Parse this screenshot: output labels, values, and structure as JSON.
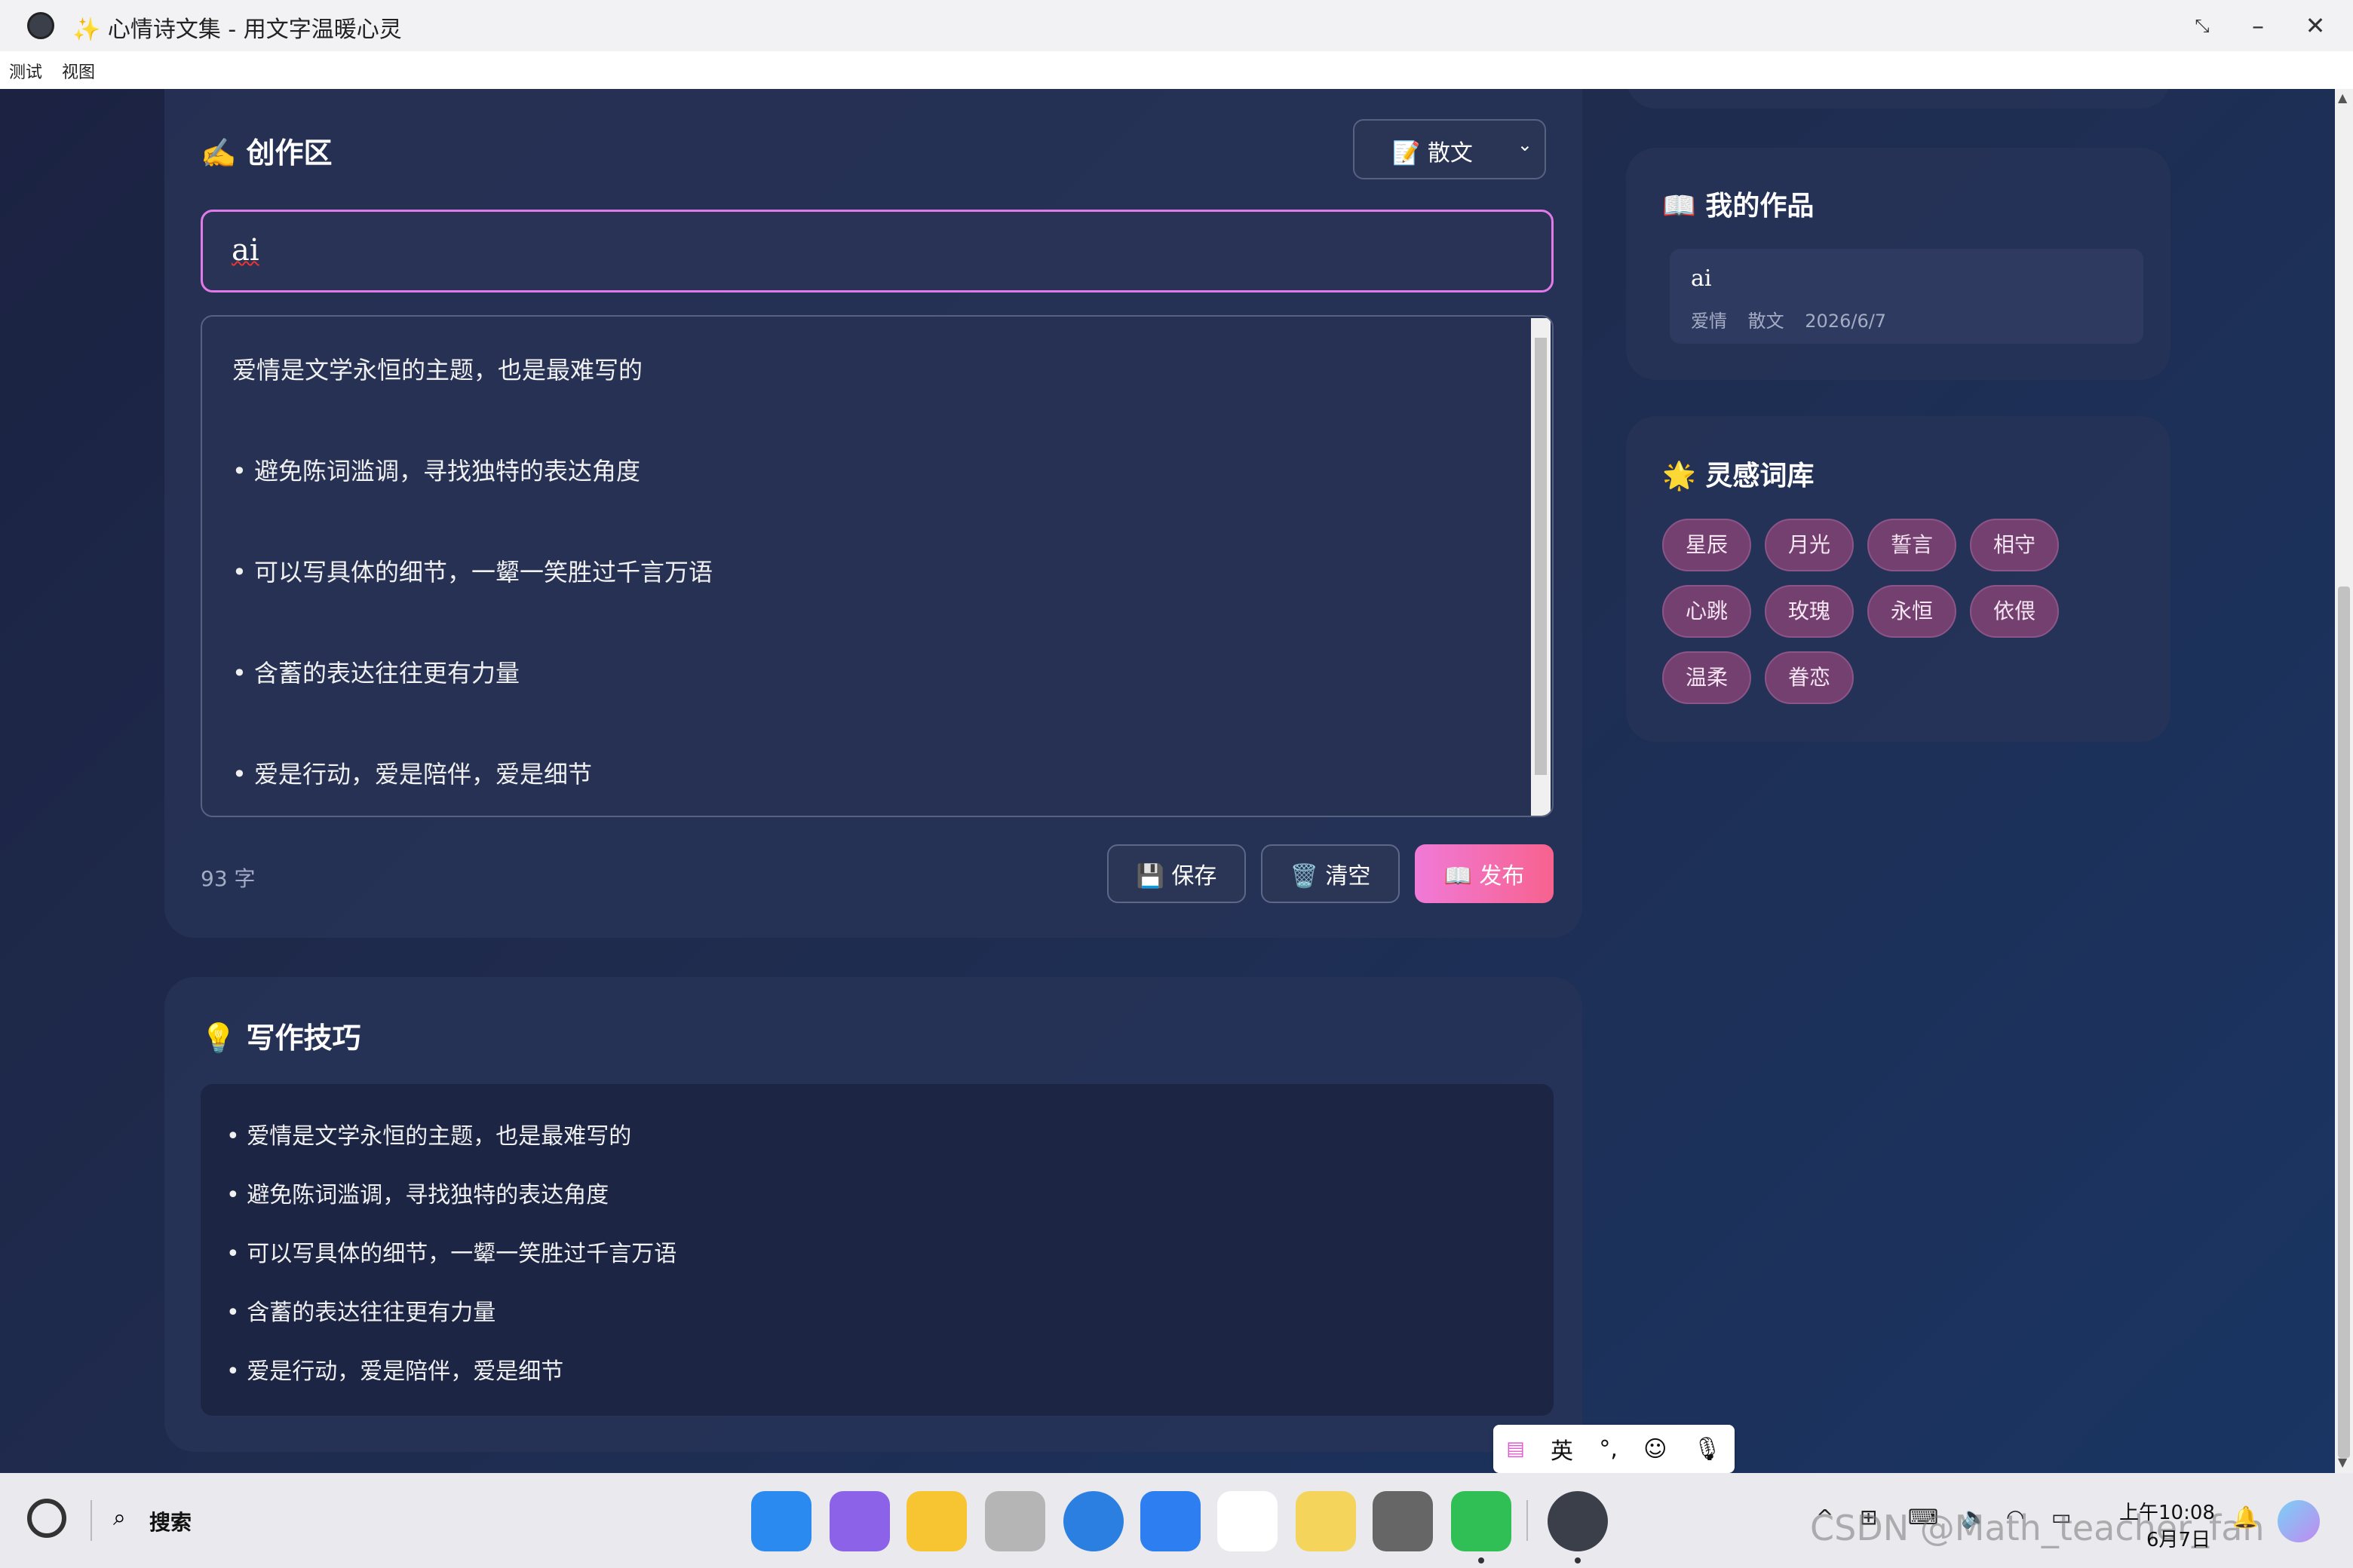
{
  "window": {
    "title": "✨ 心情诗文集 - 用文字温暖心灵"
  },
  "menu": {
    "items": [
      "测试",
      "视图"
    ]
  },
  "editor": {
    "heading": "✍️ 创作区",
    "genre_select": "📝 散文",
    "title_value": "ai",
    "content_lines": [
      "爱情是文学永恒的主题，也是最难写的",
      "• 避免陈词滥调，寻找独特的表达角度",
      "• 可以写具体的细节，一颦一笑胜过千言万语",
      "• 含蓄的表达往往更有力量",
      "• 爱是行动，爱是陪伴，爱是细节"
    ],
    "char_count": "93 字",
    "buttons": {
      "save": "💾 保存",
      "clear": "🗑️ 清空",
      "publish": "📖 发布"
    }
  },
  "tips": {
    "heading": "💡 写作技巧",
    "lines": [
      "• 爱情是文学永恒的主题，也是最难写的",
      "• 避免陈词滥调，寻找独特的表达角度",
      "• 可以写具体的细节，一颦一笑胜过千言万语",
      "• 含蓄的表达往往更有力量",
      "• 爱是行动，爱是陪伴，爱是细节"
    ]
  },
  "my_works": {
    "heading": "📖 我的作品",
    "items": [
      {
        "title": "ai",
        "mood": "爱情",
        "genre": "散文",
        "date": "2026/6/7"
      }
    ]
  },
  "inspiration": {
    "heading": "🌟 灵感词库",
    "tags": [
      "星辰",
      "月光",
      "誓言",
      "相守",
      "心跳",
      "玫瑰",
      "永恒",
      "依偎",
      "温柔",
      "眷恋"
    ]
  },
  "ime": {
    "lang": "英"
  },
  "taskbar": {
    "search_label": "搜索",
    "clock_time": "上午10:08",
    "clock_date": "6月7日",
    "watermark": "CSDN @Math_teacher_fan"
  },
  "colors": {
    "accent_pink": "#f07ad8",
    "publish_end": "#f7628e",
    "tag_bg": "#74406f",
    "card_bg": "#283458"
  }
}
